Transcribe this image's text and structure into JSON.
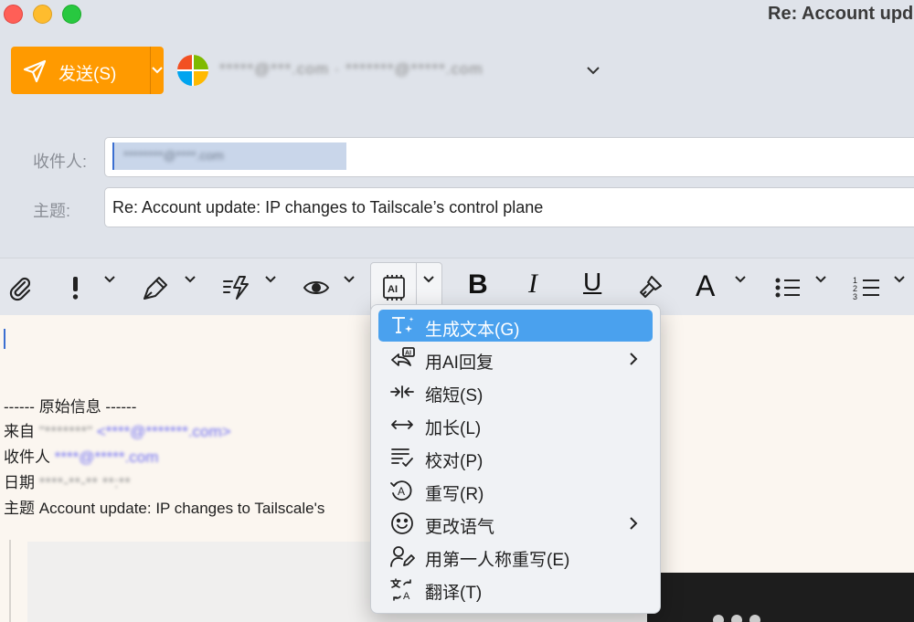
{
  "window": {
    "title": "Re: Account upd"
  },
  "send": {
    "label": "发送(S)"
  },
  "account": {
    "display": "*****@***.com · *******@*****.com"
  },
  "fields": {
    "to_label": "收件人:",
    "to_value": "********@****.com",
    "subject_label": "主题:",
    "subject_value": "Re: Account update: IP changes to Tailscale’s control plane"
  },
  "toolbar": {
    "bold_label": "B",
    "italic_label": "I",
    "underline_label": "U",
    "font_label": "A",
    "items": [
      "attach-icon",
      "priority-icon",
      "signature-pen-icon",
      "quick-parts-icon",
      "view-icon",
      "ai-chip-icon",
      "bold",
      "italic",
      "underline",
      "format-painter-icon",
      "font-color",
      "bullet-list-icon",
      "numbered-list-icon"
    ]
  },
  "compose": {
    "separator": "------ 原始信息 ------",
    "from_label": "来自",
    "from_name": "\"*******\"",
    "from_email": "<****@*******.com>",
    "to_label": "收件人",
    "to_email": "****@*****.com",
    "date_label": "日期",
    "date_value": "****-**-** **:**",
    "subject_label": "主题",
    "subject_value": "Account update: IP changes to Tailscale's"
  },
  "ai_menu": {
    "items": [
      {
        "label": "生成文本(G)",
        "icon": "generate-text-icon",
        "selected": true,
        "submenu": false
      },
      {
        "label": "用AI回复",
        "icon": "ai-reply-icon",
        "selected": false,
        "submenu": true
      },
      {
        "label": "缩短(S)",
        "icon": "shorten-icon",
        "selected": false,
        "submenu": false
      },
      {
        "label": "加长(L)",
        "icon": "lengthen-icon",
        "selected": false,
        "submenu": false
      },
      {
        "label": "校对(P)",
        "icon": "proofread-icon",
        "selected": false,
        "submenu": false
      },
      {
        "label": "重写(R)",
        "icon": "rewrite-icon",
        "selected": false,
        "submenu": false
      },
      {
        "label": "更改语气",
        "icon": "tone-icon",
        "selected": false,
        "submenu": true
      },
      {
        "label": "用第一人称重写(E)",
        "icon": "first-person-icon",
        "selected": false,
        "submenu": false
      },
      {
        "label": "翻译(T)",
        "icon": "translate-icon",
        "selected": false,
        "submenu": false
      }
    ]
  },
  "colors": {
    "accent": "#ff9a00",
    "selection": "#4aa1ee",
    "link": "#6f6ff2"
  }
}
